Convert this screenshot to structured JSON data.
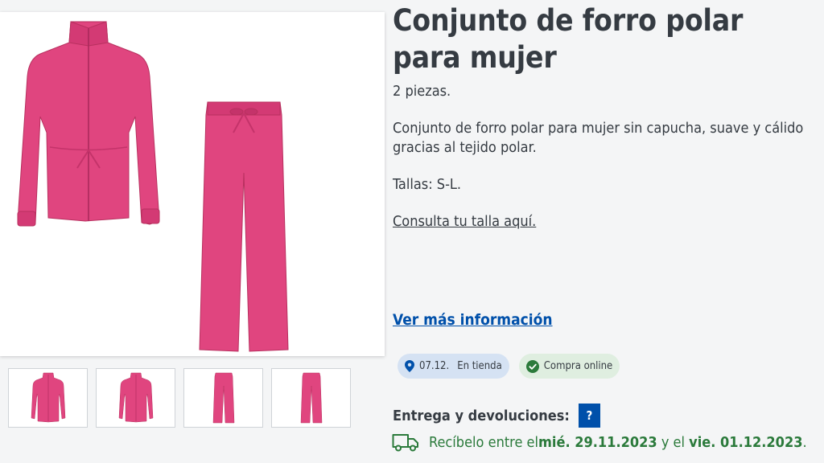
{
  "product": {
    "title": "Conjunto de forro polar para mujer",
    "pieces": "2 piezas.",
    "description": "Conjunto de forro polar para mujer sin capucha, suave y cálido gracias al tejido polar.",
    "sizes": "Tallas: S-L.",
    "size_link": "Consulta tu talla aquí.",
    "more_info": "Ver más información"
  },
  "badges": {
    "store_date": "07.12.",
    "store_label": "En tienda",
    "online_label": "Compra online"
  },
  "delivery": {
    "label": "Entrega y devoluciones:",
    "help": "?",
    "text_1": "Recíbelo entre el ",
    "date_1": "mié. 29.11.2023",
    "text_2": " y el ",
    "date_2": "vie. 01.12.2023",
    "text_3": "."
  },
  "colors": {
    "accent": "#0050aa",
    "garment": "#e0457f",
    "success": "#2b7a3b"
  },
  "gallery": {
    "thumbnails": [
      "jacket-front",
      "jacket-alt",
      "pants-front",
      "pants-alt"
    ]
  }
}
